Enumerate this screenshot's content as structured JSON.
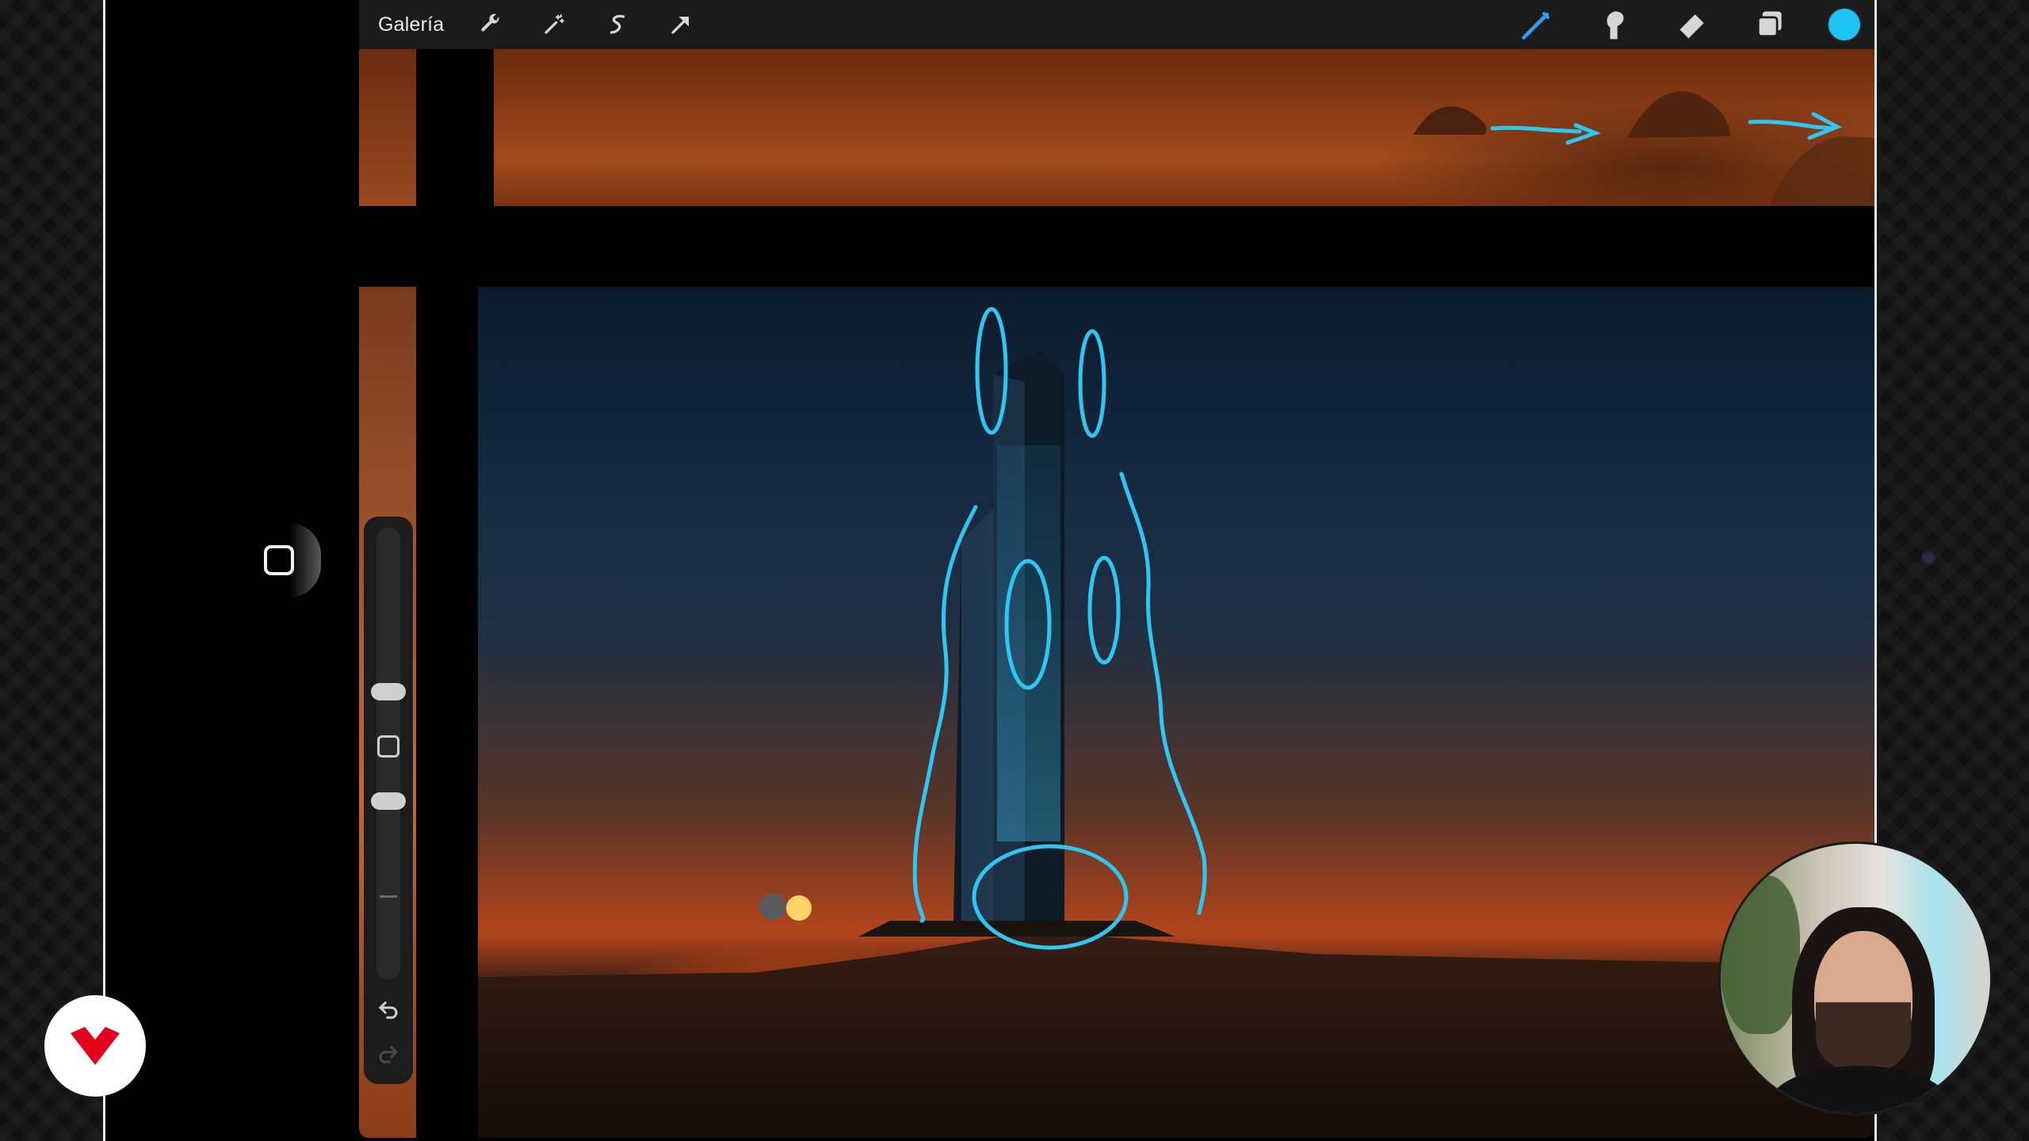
{
  "toolbar": {
    "gallery_label": "Galería",
    "left_tools": [
      "wrench-icon",
      "magic-wand-icon",
      "selection-s-icon",
      "arrow-transform-icon"
    ],
    "right_tools": [
      "brush-icon",
      "smudge-icon",
      "eraser-icon",
      "layers-icon"
    ],
    "active_color": "#1fc4f4"
  },
  "sidebar": {
    "brush_size_level": 0.22,
    "opacity_level": 0.38
  },
  "colors": {
    "accent": "#1fc4f4",
    "brand_logo": "#e3001b"
  }
}
